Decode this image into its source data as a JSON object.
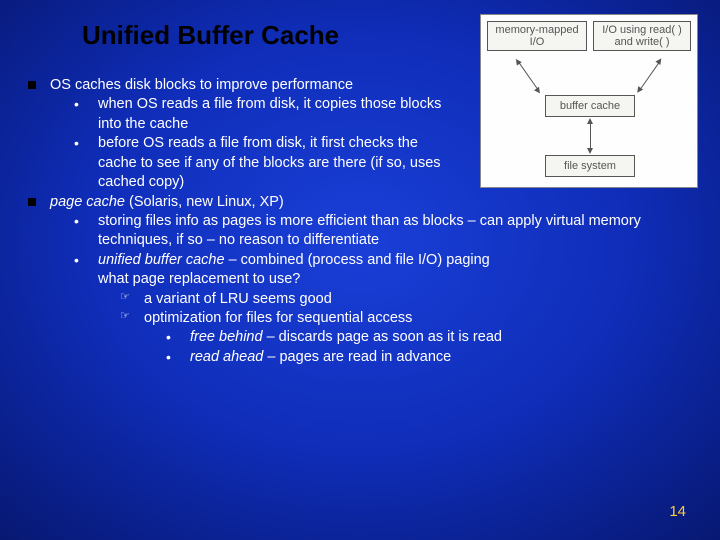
{
  "title": "Unified Buffer Cache",
  "diagram": {
    "top_left": "memory-mapped I/O",
    "top_right": "I/O using read( ) and write( )",
    "mid": "buffer cache",
    "bottom": "file system"
  },
  "bullets": {
    "b1": "OS caches disk blocks to improve performance",
    "b1a": "when OS reads a file from disk, it copies those blocks into the cache",
    "b1b": "before OS reads a file from disk, it first checks the cache to see if any of the blocks are there (if so, uses cached copy)",
    "b2a": "page cache",
    "b2b": " (Solaris, new Linux,  XP)",
    "b2_1": "storing files info as pages is more efficient than as blocks – can apply virtual memory techniques, if so – no reason to differentiate",
    "b2_2a": "unified buffer cache",
    "b2_2b": " – combined (process and file I/O) paging",
    "b2_2c": "what page replacement to use?",
    "b2_2_1": "a variant of LRU seems good",
    "b2_2_2": "optimization for files for sequential access",
    "b2_2_2a1": "free behind",
    "b2_2_2a2": " – discards page as soon as it is read",
    "b2_2_2b1": "read ahead",
    "b2_2_2b2": " – pages are read in advance"
  },
  "page_number": "14"
}
